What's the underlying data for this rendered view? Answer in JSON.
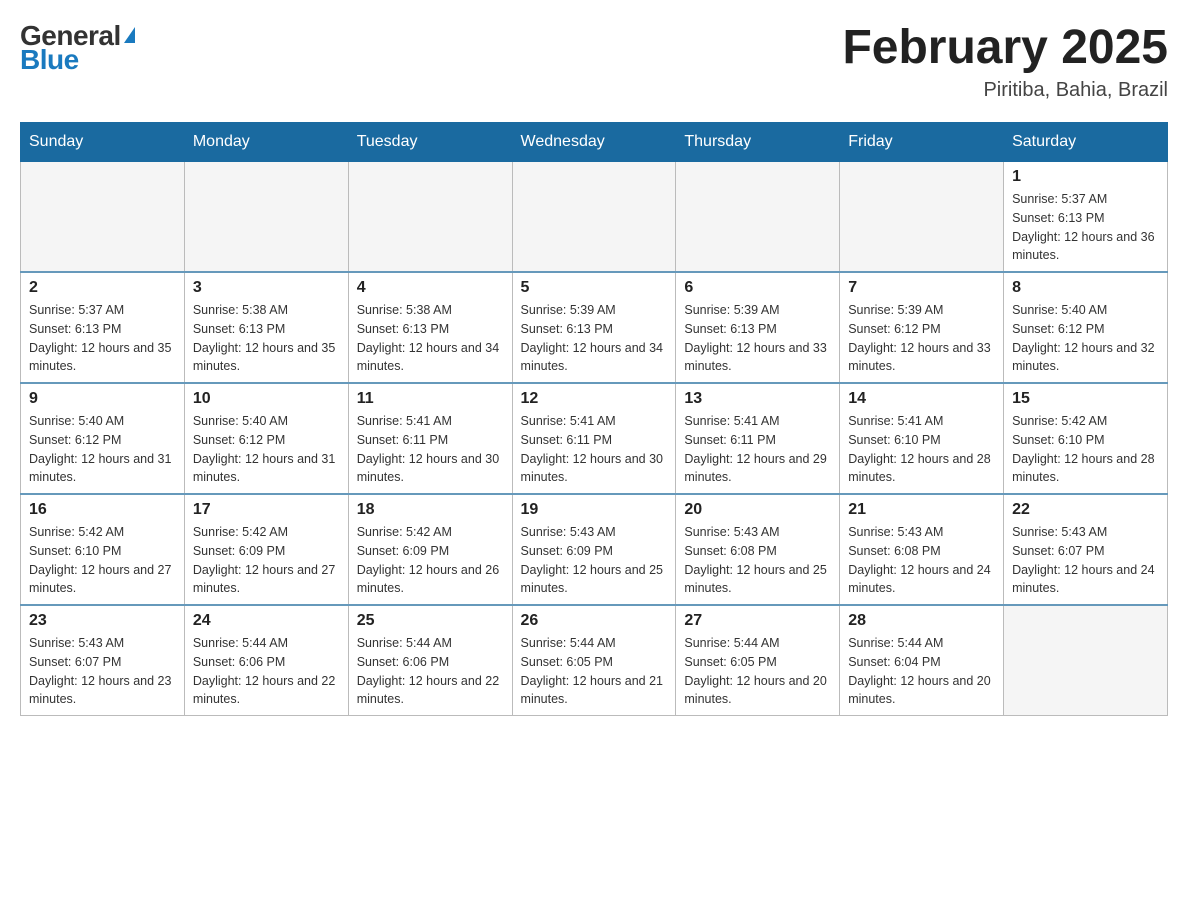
{
  "header": {
    "logo_general": "General",
    "logo_blue": "Blue",
    "month_title": "February 2025",
    "location": "Piritiba, Bahia, Brazil"
  },
  "days_of_week": [
    "Sunday",
    "Monday",
    "Tuesday",
    "Wednesday",
    "Thursday",
    "Friday",
    "Saturday"
  ],
  "weeks": [
    [
      {
        "day": "",
        "info": ""
      },
      {
        "day": "",
        "info": ""
      },
      {
        "day": "",
        "info": ""
      },
      {
        "day": "",
        "info": ""
      },
      {
        "day": "",
        "info": ""
      },
      {
        "day": "",
        "info": ""
      },
      {
        "day": "1",
        "info": "Sunrise: 5:37 AM\nSunset: 6:13 PM\nDaylight: 12 hours and 36 minutes."
      }
    ],
    [
      {
        "day": "2",
        "info": "Sunrise: 5:37 AM\nSunset: 6:13 PM\nDaylight: 12 hours and 35 minutes."
      },
      {
        "day": "3",
        "info": "Sunrise: 5:38 AM\nSunset: 6:13 PM\nDaylight: 12 hours and 35 minutes."
      },
      {
        "day": "4",
        "info": "Sunrise: 5:38 AM\nSunset: 6:13 PM\nDaylight: 12 hours and 34 minutes."
      },
      {
        "day": "5",
        "info": "Sunrise: 5:39 AM\nSunset: 6:13 PM\nDaylight: 12 hours and 34 minutes."
      },
      {
        "day": "6",
        "info": "Sunrise: 5:39 AM\nSunset: 6:13 PM\nDaylight: 12 hours and 33 minutes."
      },
      {
        "day": "7",
        "info": "Sunrise: 5:39 AM\nSunset: 6:12 PM\nDaylight: 12 hours and 33 minutes."
      },
      {
        "day": "8",
        "info": "Sunrise: 5:40 AM\nSunset: 6:12 PM\nDaylight: 12 hours and 32 minutes."
      }
    ],
    [
      {
        "day": "9",
        "info": "Sunrise: 5:40 AM\nSunset: 6:12 PM\nDaylight: 12 hours and 31 minutes."
      },
      {
        "day": "10",
        "info": "Sunrise: 5:40 AM\nSunset: 6:12 PM\nDaylight: 12 hours and 31 minutes."
      },
      {
        "day": "11",
        "info": "Sunrise: 5:41 AM\nSunset: 6:11 PM\nDaylight: 12 hours and 30 minutes."
      },
      {
        "day": "12",
        "info": "Sunrise: 5:41 AM\nSunset: 6:11 PM\nDaylight: 12 hours and 30 minutes."
      },
      {
        "day": "13",
        "info": "Sunrise: 5:41 AM\nSunset: 6:11 PM\nDaylight: 12 hours and 29 minutes."
      },
      {
        "day": "14",
        "info": "Sunrise: 5:41 AM\nSunset: 6:10 PM\nDaylight: 12 hours and 28 minutes."
      },
      {
        "day": "15",
        "info": "Sunrise: 5:42 AM\nSunset: 6:10 PM\nDaylight: 12 hours and 28 minutes."
      }
    ],
    [
      {
        "day": "16",
        "info": "Sunrise: 5:42 AM\nSunset: 6:10 PM\nDaylight: 12 hours and 27 minutes."
      },
      {
        "day": "17",
        "info": "Sunrise: 5:42 AM\nSunset: 6:09 PM\nDaylight: 12 hours and 27 minutes."
      },
      {
        "day": "18",
        "info": "Sunrise: 5:42 AM\nSunset: 6:09 PM\nDaylight: 12 hours and 26 minutes."
      },
      {
        "day": "19",
        "info": "Sunrise: 5:43 AM\nSunset: 6:09 PM\nDaylight: 12 hours and 25 minutes."
      },
      {
        "day": "20",
        "info": "Sunrise: 5:43 AM\nSunset: 6:08 PM\nDaylight: 12 hours and 25 minutes."
      },
      {
        "day": "21",
        "info": "Sunrise: 5:43 AM\nSunset: 6:08 PM\nDaylight: 12 hours and 24 minutes."
      },
      {
        "day": "22",
        "info": "Sunrise: 5:43 AM\nSunset: 6:07 PM\nDaylight: 12 hours and 24 minutes."
      }
    ],
    [
      {
        "day": "23",
        "info": "Sunrise: 5:43 AM\nSunset: 6:07 PM\nDaylight: 12 hours and 23 minutes."
      },
      {
        "day": "24",
        "info": "Sunrise: 5:44 AM\nSunset: 6:06 PM\nDaylight: 12 hours and 22 minutes."
      },
      {
        "day": "25",
        "info": "Sunrise: 5:44 AM\nSunset: 6:06 PM\nDaylight: 12 hours and 22 minutes."
      },
      {
        "day": "26",
        "info": "Sunrise: 5:44 AM\nSunset: 6:05 PM\nDaylight: 12 hours and 21 minutes."
      },
      {
        "day": "27",
        "info": "Sunrise: 5:44 AM\nSunset: 6:05 PM\nDaylight: 12 hours and 20 minutes."
      },
      {
        "day": "28",
        "info": "Sunrise: 5:44 AM\nSunset: 6:04 PM\nDaylight: 12 hours and 20 minutes."
      },
      {
        "day": "",
        "info": ""
      }
    ]
  ]
}
